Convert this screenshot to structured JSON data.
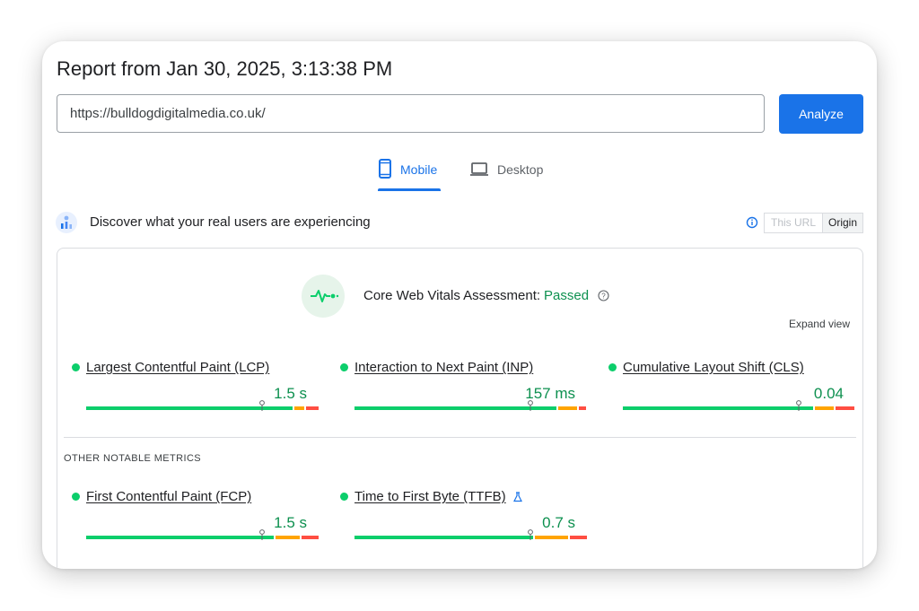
{
  "report": {
    "title": "Report from Jan 30, 2025, 3:13:38 PM"
  },
  "search": {
    "url": "https://bulldogdigitalmedia.co.uk/",
    "analyze_label": "Analyze"
  },
  "tabs": [
    {
      "label": "Mobile",
      "icon": "phone-icon",
      "selected": true
    },
    {
      "label": "Desktop",
      "icon": "laptop-icon",
      "selected": false
    }
  ],
  "crux": {
    "heading": "Discover what your real users are experiencing",
    "toggle": {
      "this_url": "This URL",
      "origin": "Origin",
      "selected": "Origin"
    },
    "assessment": {
      "label": "Core Web Vitals Assessment:",
      "status": "Passed"
    },
    "expand_label": "Expand view",
    "other_label": "OTHER NOTABLE METRICS"
  },
  "colors": {
    "good": "#0cce6b",
    "needs_improvement": "#ffa400",
    "poor": "#ff4e42",
    "accent": "#1a73e8",
    "good_text": "#0d904f"
  },
  "metrics": [
    {
      "name": "Largest Contentful Paint (LCP)",
      "value": "1.5 s",
      "distribution": [
        0.89,
        0.05,
        0.06
      ],
      "marker": 0.75,
      "experimental": false
    },
    {
      "name": "Interaction to Next Paint (INP)",
      "value": "157 ms",
      "distribution": [
        0.87,
        0.09,
        0.04
      ],
      "marker": 0.75,
      "experimental": false
    },
    {
      "name": "Cumulative Layout Shift (CLS)",
      "value": "0.04",
      "distribution": [
        0.82,
        0.09,
        0.09
      ],
      "marker": 0.75,
      "experimental": false
    },
    {
      "name": "First Contentful Paint (FCP)",
      "value": "1.5 s",
      "distribution": [
        0.81,
        0.11,
        0.08
      ],
      "marker": 0.75,
      "experimental": false
    },
    {
      "name": "Time to First Byte (TTFB)",
      "value": "0.7 s",
      "distribution": [
        0.77,
        0.15,
        0.08
      ],
      "marker": 0.75,
      "experimental": true
    }
  ]
}
